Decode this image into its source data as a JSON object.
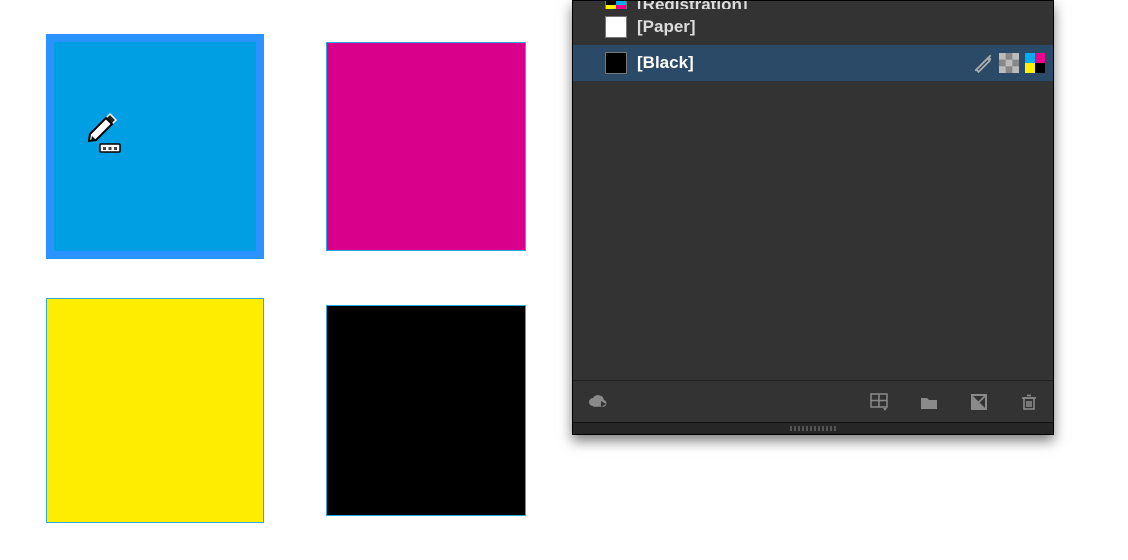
{
  "canvas": {
    "swatches": {
      "cyan": {
        "color": "#009fe3",
        "selected": true
      },
      "magenta": {
        "color": "#d9008b",
        "selected": false
      },
      "yellow": {
        "color": "#ffed00",
        "selected": false
      },
      "black": {
        "color": "#000000",
        "selected": false
      }
    },
    "cursor": "eyedropper"
  },
  "panel": {
    "rows": {
      "registration": {
        "label": "[Registration]",
        "chip": "registration",
        "selected": false,
        "locked": true
      },
      "paper": {
        "label": "[Paper]",
        "chip": "white",
        "selected": false,
        "locked": false
      },
      "black": {
        "label": "[Black]",
        "chip": "black",
        "selected": true,
        "locked": true
      }
    },
    "footerIcons": {
      "cloud": "cc-library-icon",
      "grid": "grid-view-icon",
      "folder": "new-group-icon",
      "newSwatch": "new-swatch-icon",
      "trash": "delete-icon"
    }
  }
}
